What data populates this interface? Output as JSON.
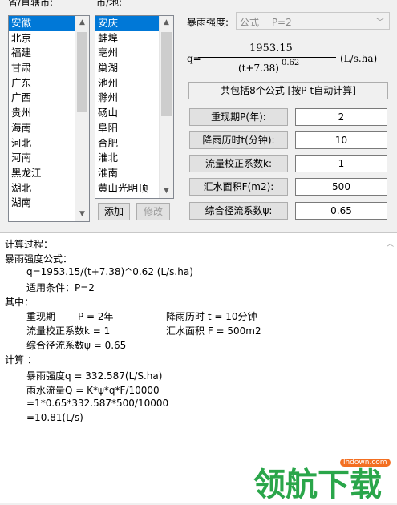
{
  "province_label": "省/直辖市:",
  "city_label": "市/地:",
  "provinces": [
    "安徽",
    "北京",
    "福建",
    "甘肃",
    "广东",
    "广西",
    "贵州",
    "海南",
    "河北",
    "河南",
    "黑龙江",
    "湖北",
    "湖南"
  ],
  "cities": [
    "安庆",
    "蚌埠",
    "亳州",
    "巢湖",
    "池州",
    "滁州",
    "砀山",
    "阜阳",
    "合肥",
    "淮北",
    "淮南",
    "黄山光明顶"
  ],
  "rain_intensity_label": "暴雨强度:",
  "formula_select": "公式一 P=2",
  "formula": {
    "q": "q=",
    "numerator": "1953.15",
    "denominator": "(t+7.38)",
    "exponent": "0.62",
    "unit": "(L/s.ha)"
  },
  "total_formula_button": "共包括8个公式 [按P-t自动计算]",
  "params": [
    {
      "label": "重现期P(年):",
      "value": "2"
    },
    {
      "label": "降雨历时t(分钟):",
      "value": "10"
    },
    {
      "label": "流量校正系数k:",
      "value": "1"
    },
    {
      "label": "汇水面积F(m2):",
      "value": "500"
    },
    {
      "label": "综合径流系数ψ:",
      "value": "0.65"
    }
  ],
  "add_button": "添加",
  "edit_button": "修改",
  "output_lines": [
    "计算过程：",
    "暴雨强度公式：",
    "q=1953.15/(t+7.38)^0.62 (L/s.ha)",
    "适用条件：P=2",
    "其中：",
    "重现期",
    "P = 2年",
    "降雨历时 t = 10分钟",
    "流量校正系数k = 1",
    "汇水面积 F = 500m2",
    "综合径流系数ψ = 0.65",
    "计算 ：",
    "暴雨强度q = 332.587(L/S.ha)",
    "雨水流量Q = K*ψ*q*F/10000",
    "=1*0.65*332.587*500/10000",
    "=10.81(L/s)"
  ],
  "watermark": {
    "text": "领航下载",
    "site": "lhdown.com"
  }
}
